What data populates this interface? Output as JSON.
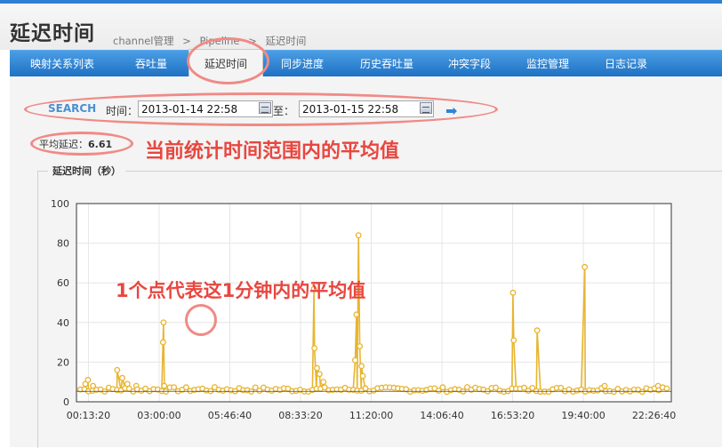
{
  "header": {
    "title": "延迟时间",
    "breadcrumb": [
      "channel管理",
      ">",
      "Pipeline",
      ">",
      "延迟时间"
    ]
  },
  "nav": {
    "items": [
      {
        "label": "映射关系列表"
      },
      {
        "label": "吞吐量"
      },
      {
        "label": "延迟时间",
        "active": true
      },
      {
        "label": "同步进度"
      },
      {
        "label": "历史吞吐量"
      },
      {
        "label": "冲突字段"
      },
      {
        "label": "监控管理"
      },
      {
        "label": "日志记录"
      }
    ]
  },
  "search": {
    "label": "SEARCH",
    "time_label": "时间：",
    "start": "2013-01-14 22:58",
    "to_label": "至：",
    "end": "2013-01-15 22:58"
  },
  "summary": {
    "avg_label": "平均延迟：",
    "avg_value": "6.61"
  },
  "annotations": {
    "avg_note": "当前统计时间范围内的平均值",
    "point_note": "1个点代表这1分钟内的平均值"
  },
  "colors": {
    "accent": "#2f7fd3",
    "series": "#e8b530",
    "annotation": "#e8463f",
    "oval": "#f08a86"
  },
  "chart_data": {
    "type": "line",
    "title": "延迟时间（秒）",
    "ylim": [
      0,
      100
    ],
    "yticks": [
      "0",
      "20",
      "40",
      "60",
      "80",
      "100"
    ],
    "xticks": [
      "00:13:20",
      "03:00:00",
      "05:46:40",
      "08:33:20",
      "11:20:00",
      "14:06:40",
      "16:53:20",
      "19:40:00",
      "22:26:40"
    ],
    "xlim_hours": [
      -0.25,
      23.12
    ],
    "baseline": 6.5,
    "series": [
      {
        "values_note": "1-minute averages; spikes listed as [hour, value]",
        "spikes": [
          [
            0.1,
            9
          ],
          [
            0.2,
            11
          ],
          [
            0.4,
            8
          ],
          [
            1.35,
            16
          ],
          [
            1.55,
            12
          ],
          [
            1.75,
            9
          ],
          [
            2.1,
            8
          ],
          [
            3.17,
            40
          ],
          [
            3.15,
            30
          ],
          [
            3.2,
            8
          ],
          [
            9.08,
            57
          ],
          [
            9.1,
            27
          ],
          [
            9.2,
            17
          ],
          [
            9.3,
            14
          ],
          [
            9.45,
            10
          ],
          [
            10.7,
            21
          ],
          [
            10.75,
            44
          ],
          [
            10.83,
            84
          ],
          [
            10.88,
            28
          ],
          [
            10.95,
            18
          ],
          [
            11.0,
            13
          ],
          [
            16.9,
            55
          ],
          [
            16.93,
            31
          ],
          [
            17.85,
            36
          ],
          [
            19.72,
            68
          ],
          [
            20.5,
            8
          ],
          [
            22.6,
            8
          ]
        ]
      }
    ]
  }
}
